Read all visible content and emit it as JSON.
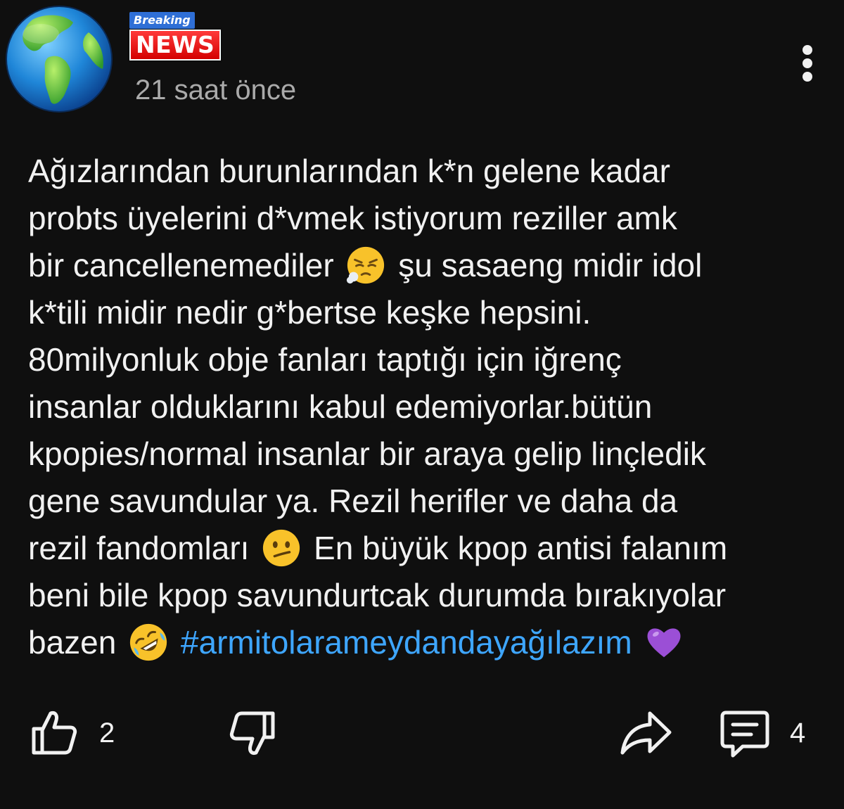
{
  "post": {
    "channel_badge": {
      "top_text": "Breaking",
      "main_text": "NEWS"
    },
    "timestamp": "21 saat önce",
    "body": {
      "line1": "Ağızlarından burunlarından k*n gelene kadar",
      "line2": "probts üyelerini d*vmek istiyorum reziller amk",
      "line3_a": "bir cancellenemediler",
      "line3_b": "şu sasaeng midir idol",
      "line4": "k*tili midir nedir g*bertse keşke hepsini.",
      "line5": "80milyonluk obje fanları taptığı için iğrenç",
      "line6": "insanlar olduklarını kabul edemiyorlar.bütün",
      "line7": "kpopies/normal insanlar bir araya gelip linçledik",
      "line8": "gene savundular ya. Rezil herifler ve daha da",
      "line9_a": "rezil fandomları",
      "line9_b": "En büyük kpop antisi falanım",
      "line10": "beni bile kpop savundurtcak durumda bırakıyolar",
      "line11_a": "bazen",
      "hashtag": "#armitolarameydandayağılazım"
    },
    "emojis": [
      "tired-face-emoji",
      "confused-face-emoji",
      "rolling-laughing-emoji",
      "purple-heart-emoji"
    ],
    "actions": {
      "like_count": "2",
      "comment_count": "4"
    },
    "icons": [
      "globe-icon",
      "more-vertical-icon",
      "thumbs-up-icon",
      "thumbs-down-icon",
      "share-icon",
      "comment-icon"
    ],
    "colors": {
      "background": "#0f0f0f",
      "text": "#f1f1f1",
      "secondary_text": "#aaaaaa",
      "hashtag": "#3ea6ff"
    }
  }
}
